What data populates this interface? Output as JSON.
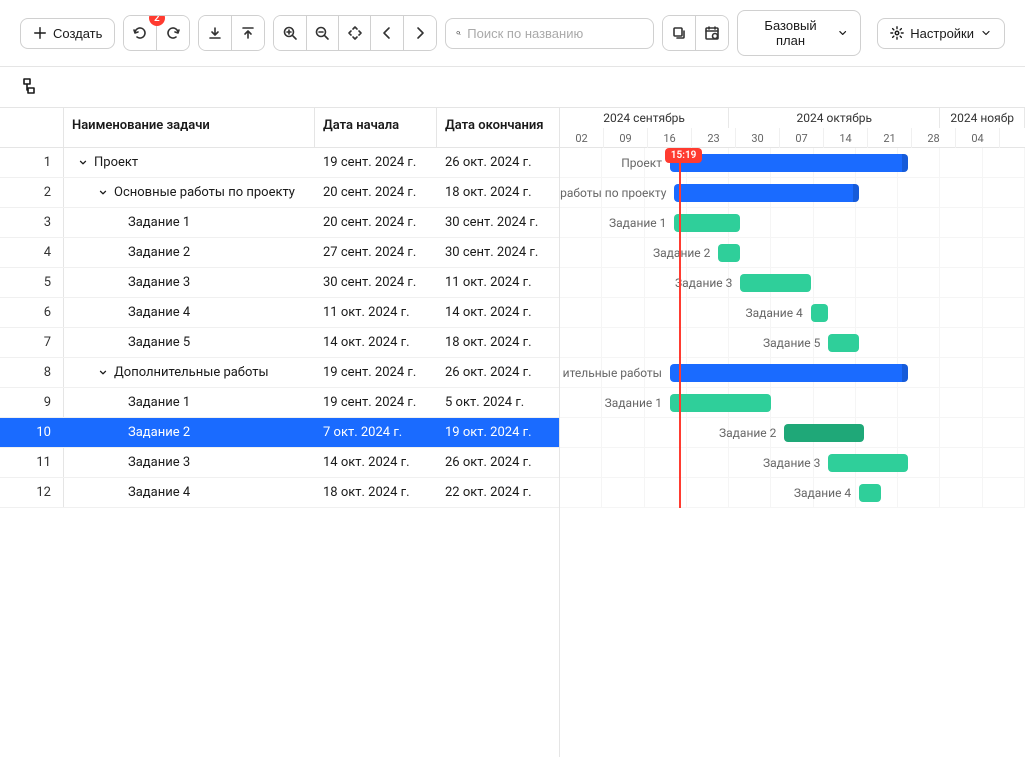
{
  "toolbar": {
    "create": "Создать",
    "undo_badge": "2",
    "search_placeholder": "Поиск по названию",
    "baseline": "Базовый план",
    "settings": "Настройки"
  },
  "columns": {
    "name": "Наименование задачи",
    "start": "Дата начала",
    "end": "Дата окончания"
  },
  "timeline": {
    "months": [
      {
        "label": "2024 сентябрь",
        "span": 4
      },
      {
        "label": "2024 октябрь",
        "span": 5
      },
      {
        "label": "2024 ноябр",
        "span": 2
      }
    ],
    "days": [
      "02",
      "09",
      "16",
      "23",
      "30",
      "07",
      "14",
      "21",
      "28",
      "04"
    ],
    "time_badge": "15:19",
    "today_index": 2.7
  },
  "rows": [
    {
      "n": "1",
      "name": "Проект",
      "indent": 0,
      "chev": true,
      "start": "19 сент. 2024 г.",
      "end": "26 окт. 2024 г.",
      "bar": {
        "label": "Проект",
        "color": "blue",
        "from": 2.5,
        "to": 7.9,
        "cap": true
      }
    },
    {
      "n": "2",
      "name": "Основные работы по проекту",
      "indent": 1,
      "chev": true,
      "start": "20 сент. 2024 г.",
      "end": "18 окт. 2024 г.",
      "bar": {
        "label": "работы по проекту",
        "color": "blue",
        "from": 2.6,
        "to": 6.8,
        "cap": true
      }
    },
    {
      "n": "3",
      "name": "Задание 1",
      "indent": 2,
      "start": "20 сент. 2024 г.",
      "end": "30 сент. 2024 г.",
      "bar": {
        "label": "Задание 1",
        "color": "green",
        "from": 2.6,
        "to": 4.1
      }
    },
    {
      "n": "4",
      "name": "Задание 2",
      "indent": 2,
      "start": "27 сент. 2024 г.",
      "end": "30 сент. 2024 г.",
      "bar": {
        "label": "Задание 2",
        "color": "green",
        "from": 3.6,
        "to": 4.1
      }
    },
    {
      "n": "5",
      "name": "Задание 3",
      "indent": 2,
      "start": "30 сент. 2024 г.",
      "end": "11 окт. 2024 г.",
      "bar": {
        "label": "Задание 3",
        "color": "green",
        "from": 4.1,
        "to": 5.7
      }
    },
    {
      "n": "6",
      "name": "Задание 4",
      "indent": 2,
      "start": "11 окт. 2024 г.",
      "end": "14 окт. 2024 г.",
      "bar": {
        "label": "Задание 4",
        "color": "green",
        "from": 5.7,
        "to": 6.1
      }
    },
    {
      "n": "7",
      "name": "Задание 5",
      "indent": 2,
      "start": "14 окт. 2024 г.",
      "end": "18 окт. 2024 г.",
      "bar": {
        "label": "Задание 5",
        "color": "green",
        "from": 6.1,
        "to": 6.8
      }
    },
    {
      "n": "8",
      "name": "Дополнительные работы",
      "indent": 1,
      "chev": true,
      "start": "19 сент. 2024 г.",
      "end": "26 окт. 2024 г.",
      "bar": {
        "label": "ительные работы",
        "color": "blue",
        "from": 2.5,
        "to": 7.9,
        "cap": true
      }
    },
    {
      "n": "9",
      "name": "Задание 1",
      "indent": 2,
      "start": "19 сент. 2024 г.",
      "end": "5 окт. 2024 г.",
      "bar": {
        "label": "Задание 1",
        "color": "green",
        "from": 2.5,
        "to": 4.8
      }
    },
    {
      "n": "10",
      "name": "Задание 2",
      "indent": 2,
      "start": "7 окт. 2024 г.",
      "end": "19 окт. 2024 г.",
      "selected": true,
      "bar": {
        "label": "Задание 2",
        "color": "darkgreen",
        "from": 5.1,
        "to": 6.9
      }
    },
    {
      "n": "11",
      "name": "Задание 3",
      "indent": 2,
      "start": "14 окт. 2024 г.",
      "end": "26 окт. 2024 г.",
      "bar": {
        "label": "Задание 3",
        "color": "green",
        "from": 6.1,
        "to": 7.9
      }
    },
    {
      "n": "12",
      "name": "Задание 4",
      "indent": 2,
      "start": "18 окт. 2024 г.",
      "end": "22 окт. 2024 г.",
      "bar": {
        "label": "Задание 4",
        "color": "green",
        "from": 6.8,
        "to": 7.3
      }
    }
  ]
}
